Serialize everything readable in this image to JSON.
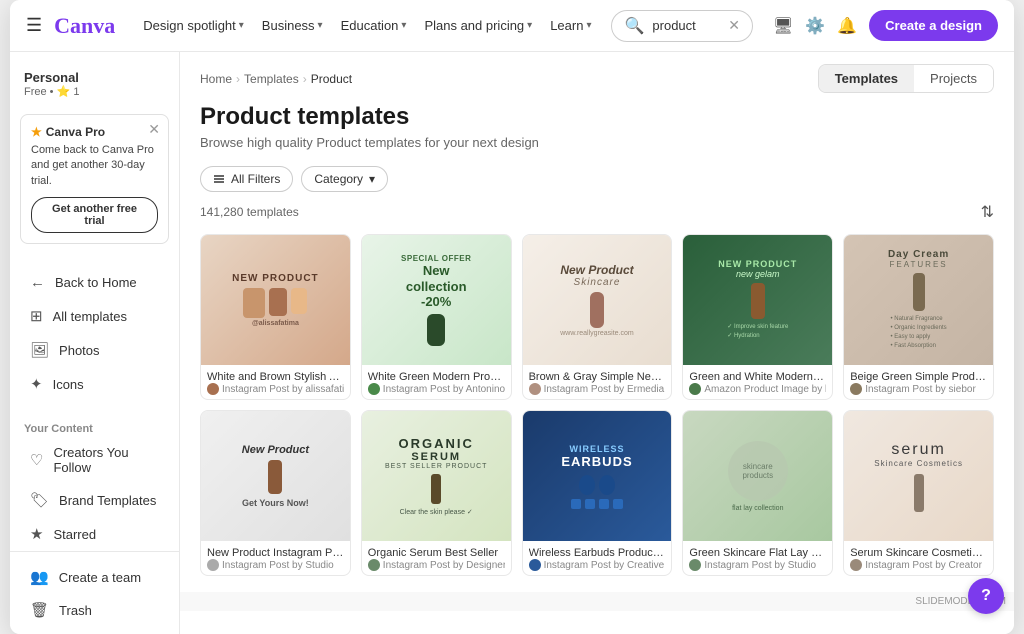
{
  "nav": {
    "logo": "Canva",
    "hamburger_icon": "☰",
    "links": [
      {
        "label": "Design spotlight",
        "has_chevron": true
      },
      {
        "label": "Business",
        "has_chevron": true
      },
      {
        "label": "Education",
        "has_chevron": true
      },
      {
        "label": "Plans and pricing",
        "has_chevron": true
      },
      {
        "label": "Learn",
        "has_chevron": true
      }
    ],
    "search_placeholder": "product",
    "search_value": "product",
    "icons": [
      "🖥",
      "⚙",
      "🔔"
    ],
    "create_btn": "Create a design"
  },
  "sidebar": {
    "username": "Personal",
    "plan": "Free • ⭐ 1",
    "promo": {
      "title": "Canva Pro",
      "text": "Come back to Canva Pro and get another 30-day trial.",
      "btn": "Get another free trial"
    },
    "items": [
      {
        "icon": "←",
        "label": "Back to Home"
      },
      {
        "icon": "⊞",
        "label": "All templates"
      },
      {
        "icon": "🖼",
        "label": "Photos"
      },
      {
        "icon": "✦",
        "label": "Icons"
      }
    ],
    "your_content": "Your Content",
    "content_items": [
      {
        "icon": "♡",
        "label": "Creators You Follow"
      },
      {
        "icon": "🏷",
        "label": "Brand Templates"
      },
      {
        "icon": "★",
        "label": "Starred"
      }
    ],
    "bottom_items": [
      {
        "icon": "👥",
        "label": "Create a team"
      },
      {
        "icon": "🗑",
        "label": "Trash"
      }
    ]
  },
  "breadcrumb": {
    "home": "Home",
    "templates": "Templates",
    "current": "Product"
  },
  "tabs": {
    "templates": "Templates",
    "projects": "Projects"
  },
  "page": {
    "title": "Product templates",
    "subtitle": "Browse high quality Product templates for your next design",
    "count": "141,280 templates",
    "filter_btn": "All Filters",
    "category_btn": "Category"
  },
  "templates": [
    {
      "name": "White and Brown Stylish Appliance...",
      "author": "Instagram Post by alissafatima",
      "bg_class": "thumb-1",
      "thumb_text": "NEW PRODUCT",
      "thumb_sub": "@alissafatima"
    },
    {
      "name": "White Green Modern Product Mark...",
      "author": "Instagram Post by Antonino De Stefano",
      "bg_class": "thumb-2",
      "thumb_text": "SPECIAL OFFER\nNew collection\n-20%",
      "thumb_sub": ""
    },
    {
      "name": "Brown & Gray Simple New Skincare...",
      "author": "Instagram Post by Ermedia Studio",
      "bg_class": "thumb-3",
      "thumb_text": "New Product\nSkincare",
      "thumb_sub": "www.reallygreasite.com"
    },
    {
      "name": "Green and White Modern Skincare ...",
      "author": "Amazon Product Image by kavilaws",
      "bg_class": "thumb-4",
      "thumb_text": "NEW PRODUCT\nnew gelam",
      "thumb_sub": ""
    },
    {
      "name": "Beige Green Simple Product Featur...",
      "author": "Instagram Post by siebor",
      "bg_class": "thumb-5",
      "thumb_text": "Day Cream\nFEATURES",
      "thumb_sub": "• Natural Fragrance\n• Organic Ingredients\n• Easy to apply\n• Fast Absorption"
    },
    {
      "name": "New Product Instagram Post",
      "author": "Instagram Post by Studio",
      "bg_class": "thumb-6",
      "thumb_text": "New Product\nGet Yours Now!",
      "thumb_sub": ""
    },
    {
      "name": "Organic Serum Best Seller",
      "author": "Instagram Post by Designer",
      "bg_class": "thumb-7",
      "thumb_text": "ORGANIC\nSERUM\nBEST SELLER PRODUCT",
      "thumb_sub": "Clear the skin please ✓"
    },
    {
      "name": "Wireless Earbuds Product Promo",
      "author": "Instagram Post by Creative",
      "bg_class": "thumb-8",
      "thumb_text": "WIRELESS\nEARBUDS",
      "thumb_sub": ""
    },
    {
      "name": "Green Skincare Flat Lay Product",
      "author": "Instagram Post by Studio",
      "bg_class": "thumb-9",
      "thumb_text": "",
      "thumb_sub": ""
    },
    {
      "name": "Serum Skincare Cosmetics Product",
      "author": "Instagram Post by Creator",
      "bg_class": "thumb-10",
      "thumb_text": "serum\nSkincare Cosmetics",
      "thumb_sub": ""
    }
  ],
  "watermark": "SLIDEMODEL.COM"
}
